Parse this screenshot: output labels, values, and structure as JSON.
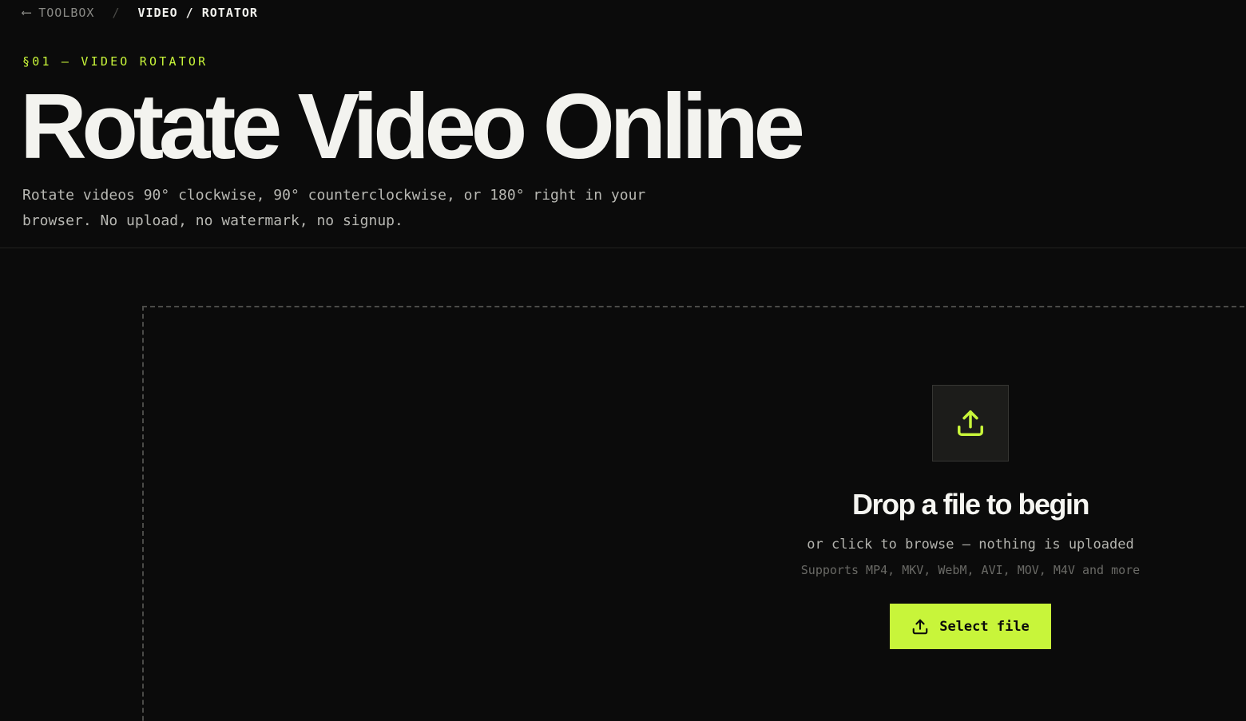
{
  "breadcrumb": {
    "back_arrow": "⟵",
    "back_label": "TOOLBOX",
    "separator": "/",
    "current": "VIDEO / ROTATOR"
  },
  "eyebrow": "§01 — VIDEO ROTATOR",
  "title": "Rotate Video Online",
  "subtitle": "Rotate videos 90° clockwise, 90° counterclockwise, or 180° right in your browser. No upload, no watermark, no signup.",
  "dropzone": {
    "icon": "upload-icon",
    "heading": "Drop a file to begin",
    "subtext": "or click to browse — nothing is uploaded",
    "formats": "Supports MP4, MKV, WebM, AVI, MOV, M4V and more",
    "button_label": "Select file",
    "button_icon": "upload-icon"
  },
  "colors": {
    "background": "#0b0b0b",
    "accent": "#c8f53a",
    "text": "#f2f2ee",
    "muted": "#8a8a86"
  }
}
